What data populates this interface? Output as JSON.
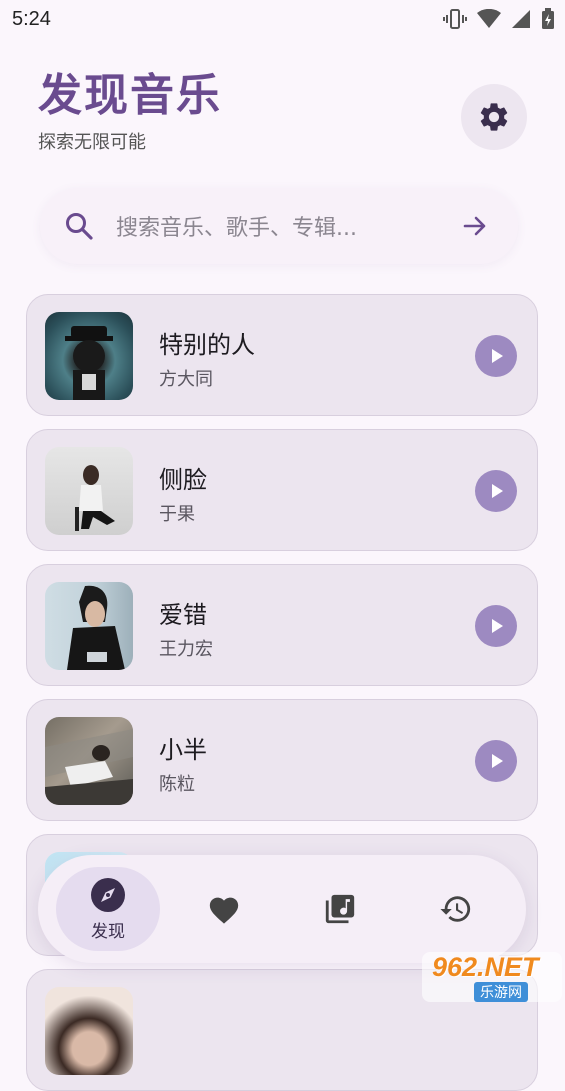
{
  "status_bar": {
    "time": "5:24",
    "icons": [
      "vibrate-icon",
      "wifi-icon",
      "signal-icon",
      "battery-icon"
    ]
  },
  "header": {
    "title": "发现音乐",
    "subtitle": "探索无限可能",
    "settings_icon": "gear-icon"
  },
  "search": {
    "placeholder": "搜索音乐、歌手、专辑..."
  },
  "songs": [
    {
      "title": "特别的人",
      "artist": "方大同"
    },
    {
      "title": "侧脸",
      "artist": "于果"
    },
    {
      "title": "爱错",
      "artist": "王力宏"
    },
    {
      "title": "小半",
      "artist": "陈粒"
    },
    {
      "title": "",
      "artist": ""
    },
    {
      "title": "",
      "artist": ""
    }
  ],
  "bottom_nav": {
    "items": [
      {
        "label": "发现",
        "icon": "compass-icon",
        "active": true
      },
      {
        "label": "",
        "icon": "heart-icon",
        "active": false
      },
      {
        "label": "",
        "icon": "music-library-icon",
        "active": false
      },
      {
        "label": "",
        "icon": "history-icon",
        "active": false
      }
    ]
  },
  "watermark": {
    "top": "962.NET",
    "bottom": "乐游网"
  },
  "colors": {
    "accent": "#6a4b8f",
    "play": "#9d8ac1",
    "card": "#ece5ef",
    "background": "#fbf6fc"
  }
}
